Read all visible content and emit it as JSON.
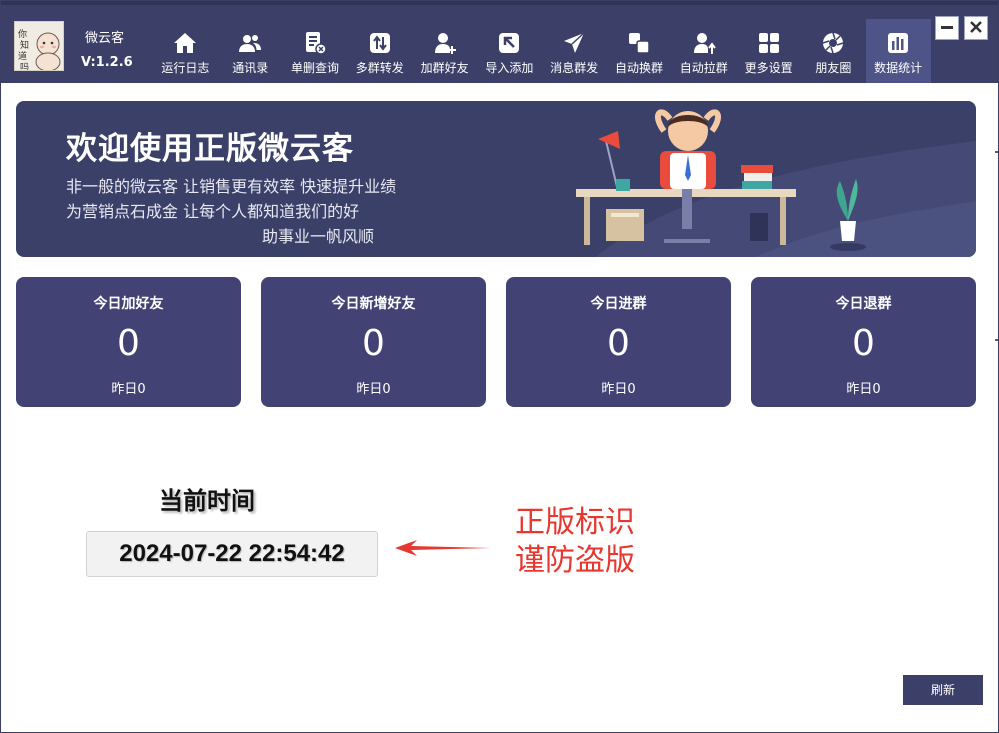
{
  "app": {
    "name": "微云客",
    "version": "V:1.2.6",
    "avatar_text": "你知道吗"
  },
  "nav": {
    "items": [
      {
        "label": "运行日志",
        "icon": "home-icon"
      },
      {
        "label": "通讯录",
        "icon": "contacts-icon"
      },
      {
        "label": "单删查询",
        "icon": "delete-check-icon"
      },
      {
        "label": "多群转发",
        "icon": "forward-icon"
      },
      {
        "label": "加群好友",
        "icon": "add-friend-icon"
      },
      {
        "label": "导入添加",
        "icon": "import-icon"
      },
      {
        "label": "消息群发",
        "icon": "send-icon"
      },
      {
        "label": "自动换群",
        "icon": "switch-group-icon"
      },
      {
        "label": "自动拉群",
        "icon": "pull-group-icon"
      },
      {
        "label": "更多设置",
        "icon": "grid-icon"
      },
      {
        "label": "朋友圈",
        "icon": "aperture-icon"
      },
      {
        "label": "数据统计",
        "icon": "bar-chart-icon"
      }
    ],
    "active": "数据统计"
  },
  "window_controls": {
    "minimize_icon": "minimize-icon",
    "close_icon": "close-icon"
  },
  "banner": {
    "title": "欢迎使用正版微云客",
    "line1": "非一般的微云客  让销售更有效率  快速提升业绩",
    "line2": "为营销点石成金  让每个人都知道我们的好",
    "line3": "助事业一帆风顺"
  },
  "stats": [
    {
      "title": "今日加好友",
      "value": "0",
      "yesterday": "昨日0"
    },
    {
      "title": "今日新增好友",
      "value": "0",
      "yesterday": "昨日0"
    },
    {
      "title": "今日进群",
      "value": "0",
      "yesterday": "昨日0"
    },
    {
      "title": "今日退群",
      "value": "0",
      "yesterday": "昨日0"
    }
  ],
  "clock": {
    "label": "当前时间",
    "value": "2024-07-22 22:54:42"
  },
  "annotation": {
    "line1": "正版标识",
    "line2": "谨防盗版"
  },
  "actions": {
    "refresh_label": "刷新"
  },
  "colors": {
    "header": "#3c4068",
    "active_tab": "#4e5388",
    "card": "#434275",
    "annotation": "#e8372e"
  }
}
